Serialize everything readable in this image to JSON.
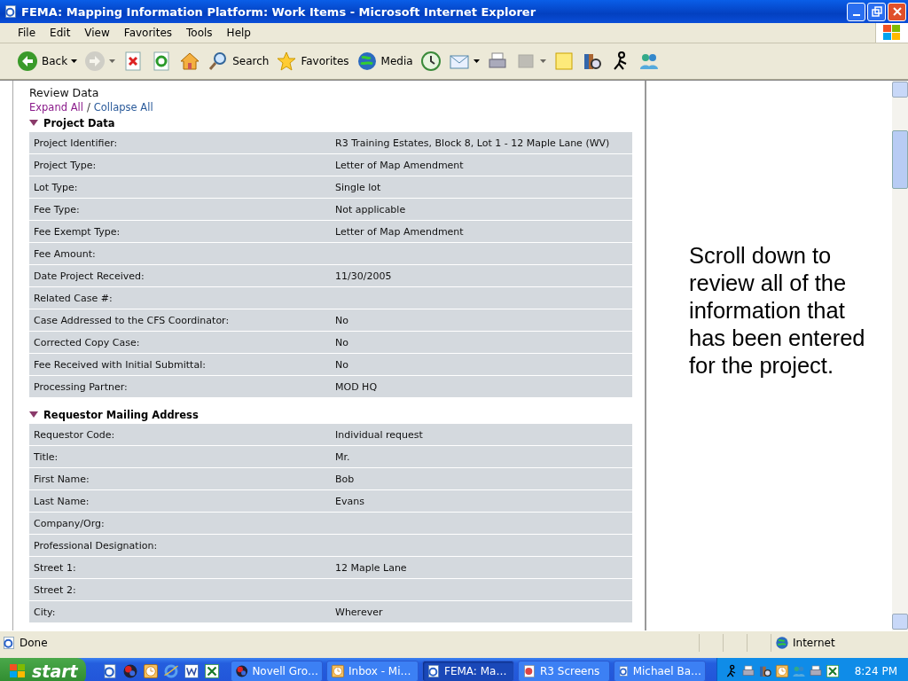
{
  "window": {
    "title": "FEMA: Mapping Information Platform: Work Items - Microsoft Internet Explorer"
  },
  "menu": [
    "File",
    "Edit",
    "View",
    "Favorites",
    "Tools",
    "Help"
  ],
  "toolbar": [
    {
      "kind": "back",
      "label": "Back",
      "dropdown": true,
      "disabled": false
    },
    {
      "kind": "forward",
      "dropdown": true,
      "disabled": true
    },
    {
      "kind": "stop",
      "dropdown": false,
      "disabled": false
    },
    {
      "kind": "refresh",
      "dropdown": false,
      "disabled": false
    },
    {
      "kind": "home",
      "dropdown": false,
      "disabled": false
    },
    {
      "kind": "search",
      "label": "Search",
      "dropdown": false,
      "disabled": false
    },
    {
      "kind": "favorites",
      "label": "Favorites",
      "dropdown": false,
      "disabled": false
    },
    {
      "kind": "media",
      "label": "Media",
      "dropdown": false,
      "disabled": false
    },
    {
      "kind": "history",
      "dropdown": false,
      "disabled": false
    },
    {
      "kind": "mail",
      "dropdown": true,
      "disabled": false
    },
    {
      "kind": "print",
      "dropdown": false,
      "disabled": false
    },
    {
      "kind": "edit",
      "dropdown": true,
      "disabled": true
    },
    {
      "kind": "discuss",
      "dropdown": false,
      "disabled": false
    },
    {
      "kind": "research",
      "dropdown": false,
      "disabled": false
    },
    {
      "kind": "messenger",
      "dropdown": false,
      "disabled": false
    },
    {
      "kind": "contacts",
      "dropdown": false,
      "disabled": false
    }
  ],
  "page": {
    "heading": "Review Data",
    "links": [
      {
        "label": "Expand All",
        "visited": true
      },
      {
        "label": "Collapse All",
        "visited": false
      }
    ],
    "link_separator": "/",
    "sections": [
      {
        "title": "Project Data",
        "expanded": true,
        "rows": [
          {
            "label": "Project Identifier:",
            "value": "R3 Training Estates, Block 8, Lot 1 - 12 Maple Lane (WV)"
          },
          {
            "label": "Project Type:",
            "value": "Letter of Map Amendment"
          },
          {
            "label": "Lot Type:",
            "value": "Single lot"
          },
          {
            "label": "Fee Type:",
            "value": "Not applicable"
          },
          {
            "label": "Fee Exempt Type:",
            "value": "Letter of Map Amendment"
          },
          {
            "label": "Fee Amount:"
          },
          {
            "label": "Date Project Received:",
            "value": "11/30/2005"
          },
          {
            "label": "Related Case #:"
          },
          {
            "label": "Case Addressed to the CFS Coordinator:",
            "value": "No"
          },
          {
            "label": "Corrected Copy Case:",
            "value": "No"
          },
          {
            "label": "Fee Received with Initial Submittal:",
            "value": "No"
          },
          {
            "label": "Processing Partner:",
            "value": "MOD HQ"
          }
        ]
      },
      {
        "title": "Requestor Mailing Address",
        "expanded": true,
        "rows": [
          {
            "label": "Requestor Code:",
            "value": "Individual request"
          },
          {
            "label": "Title:",
            "value": "Mr."
          },
          {
            "label": "First Name:",
            "value": "Bob"
          },
          {
            "label": "Last Name:",
            "value": "Evans"
          },
          {
            "label": "Company/Org:"
          },
          {
            "label": "Professional Designation:"
          },
          {
            "label": "Street 1:",
            "value": "12 Maple Lane"
          },
          {
            "label": "Street 2:"
          },
          {
            "label": "City:",
            "value": "Wherever"
          }
        ]
      }
    ],
    "note": "Scroll down to review all of the information that has been entered for the project."
  },
  "status_bar": {
    "text": "Done",
    "zone": "Internet"
  },
  "taskbar": {
    "start": "start",
    "quick_launch": [
      {
        "kind": "ie-edit"
      },
      {
        "kind": "novell"
      },
      {
        "kind": "outlook"
      },
      {
        "kind": "ie"
      },
      {
        "kind": "word"
      },
      {
        "kind": "excel"
      }
    ],
    "tasks": [
      {
        "label": "Novell Gro…",
        "kind": "novell",
        "selected": false
      },
      {
        "label": "Inbox - Mi…",
        "kind": "outlook",
        "selected": false
      },
      {
        "label": "FEMA: Ma…",
        "kind": "ie-edit",
        "selected": true
      },
      {
        "label": "R3 Screens",
        "kind": "ppt",
        "selected": false
      },
      {
        "label": "Michael Ba…",
        "kind": "ie-edit",
        "selected": false
      }
    ],
    "clock": "8:24 PM"
  }
}
